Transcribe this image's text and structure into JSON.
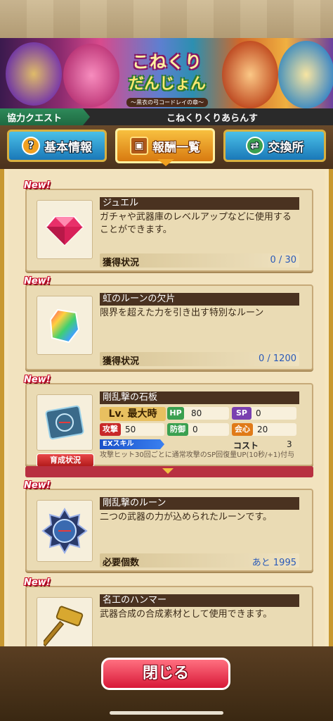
{
  "banner": {
    "logo_line1": "こねくり",
    "logo_line2": "だんじょん",
    "logo_sub": "〜黒衣の弓コードレイの章〜"
  },
  "quest": {
    "tag": "協力クエスト",
    "name": "こねくりくりあらんす"
  },
  "tabs": [
    {
      "label": "基本情報",
      "icon": "question-icon"
    },
    {
      "label": "報酬一覧",
      "icon": "treasure-chest-icon"
    },
    {
      "label": "交換所",
      "icon": "exchange-icon"
    }
  ],
  "new_badge": "New!",
  "items": [
    {
      "title": "ジュエル",
      "description": "ガチャや武器庫のレベルアップなどに使用することができます。",
      "status_label": "獲得状況",
      "status_value": "0 / 30",
      "icon": "gem-icon"
    },
    {
      "title": "虹のルーンの欠片",
      "description": "限界を超えた力を引き出す特別なルーン",
      "status_label": "獲得状況",
      "status_value": "0 / 1200",
      "icon": "rainbow-rune-shard-icon"
    },
    {
      "title": "剛乱撃の石板",
      "level": "Lv. 最大時",
      "stats": {
        "hp_label": "HP",
        "hp": "80",
        "sp_label": "SP",
        "sp": "0",
        "atk_label": "攻撃",
        "atk": "50",
        "def_label": "防御",
        "def": "0",
        "crit_label": "会心",
        "crit": "20"
      },
      "ex_label": "EXスキル",
      "cost_label": "コスト",
      "cost_value": "3",
      "ex_description": "攻撃ヒット30回ごとに通常攻撃のSP回復量UP(10秒/+1)付与",
      "grow_button": "育成状況",
      "icon": "stone-tablet-icon"
    },
    {
      "title": "剛乱撃のルーン",
      "description": "二つの武器の力が込められたルーンです。",
      "status_label": "必要個数",
      "status_value": "あと 1995",
      "icon": "rune-icon"
    },
    {
      "title": "名工のハンマー",
      "description": "武器合成の合成素材として使用できます。",
      "icon": "hammer-icon"
    }
  ],
  "close_button": "閉じる",
  "colors": {
    "hp": "#3aa050",
    "sp": "#7a40b0",
    "atk": "#c82828",
    "def": "#3aa050",
    "crit": "#e07a18",
    "status_value": "#2a5ab8"
  }
}
